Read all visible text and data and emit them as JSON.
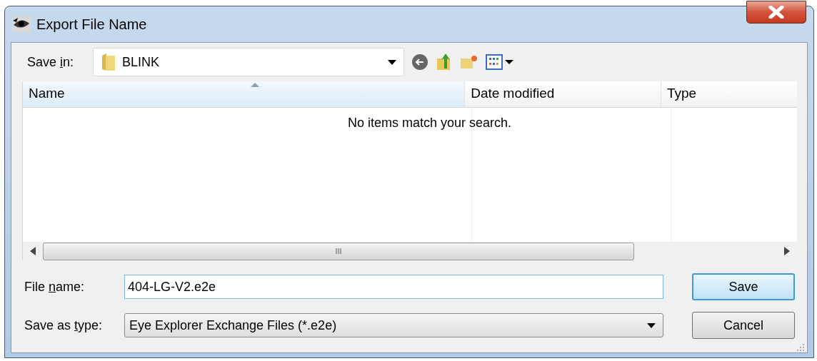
{
  "window": {
    "title": "Export File Name"
  },
  "save_in": {
    "label_parts": [
      "Save ",
      "i",
      "n:"
    ],
    "value": "BLINK"
  },
  "list": {
    "columns": [
      {
        "label": "Name",
        "sorted": true
      },
      {
        "label": "Date modified",
        "sorted": false
      },
      {
        "label": "Type",
        "sorted": false
      }
    ],
    "empty_message": "No items match your search.",
    "scrollbar_grip": "III"
  },
  "file_name": {
    "label_parts": [
      "File ",
      "n",
      "ame:"
    ],
    "value": "404-LG-V2.e2e"
  },
  "save_as_type": {
    "label_parts": [
      "Save as ",
      "t",
      "ype:"
    ],
    "value": "Eye Explorer Exchange Files (*.e2e)"
  },
  "buttons": [
    {
      "label": "Save",
      "default": true
    },
    {
      "label": "Cancel",
      "default": false
    }
  ]
}
